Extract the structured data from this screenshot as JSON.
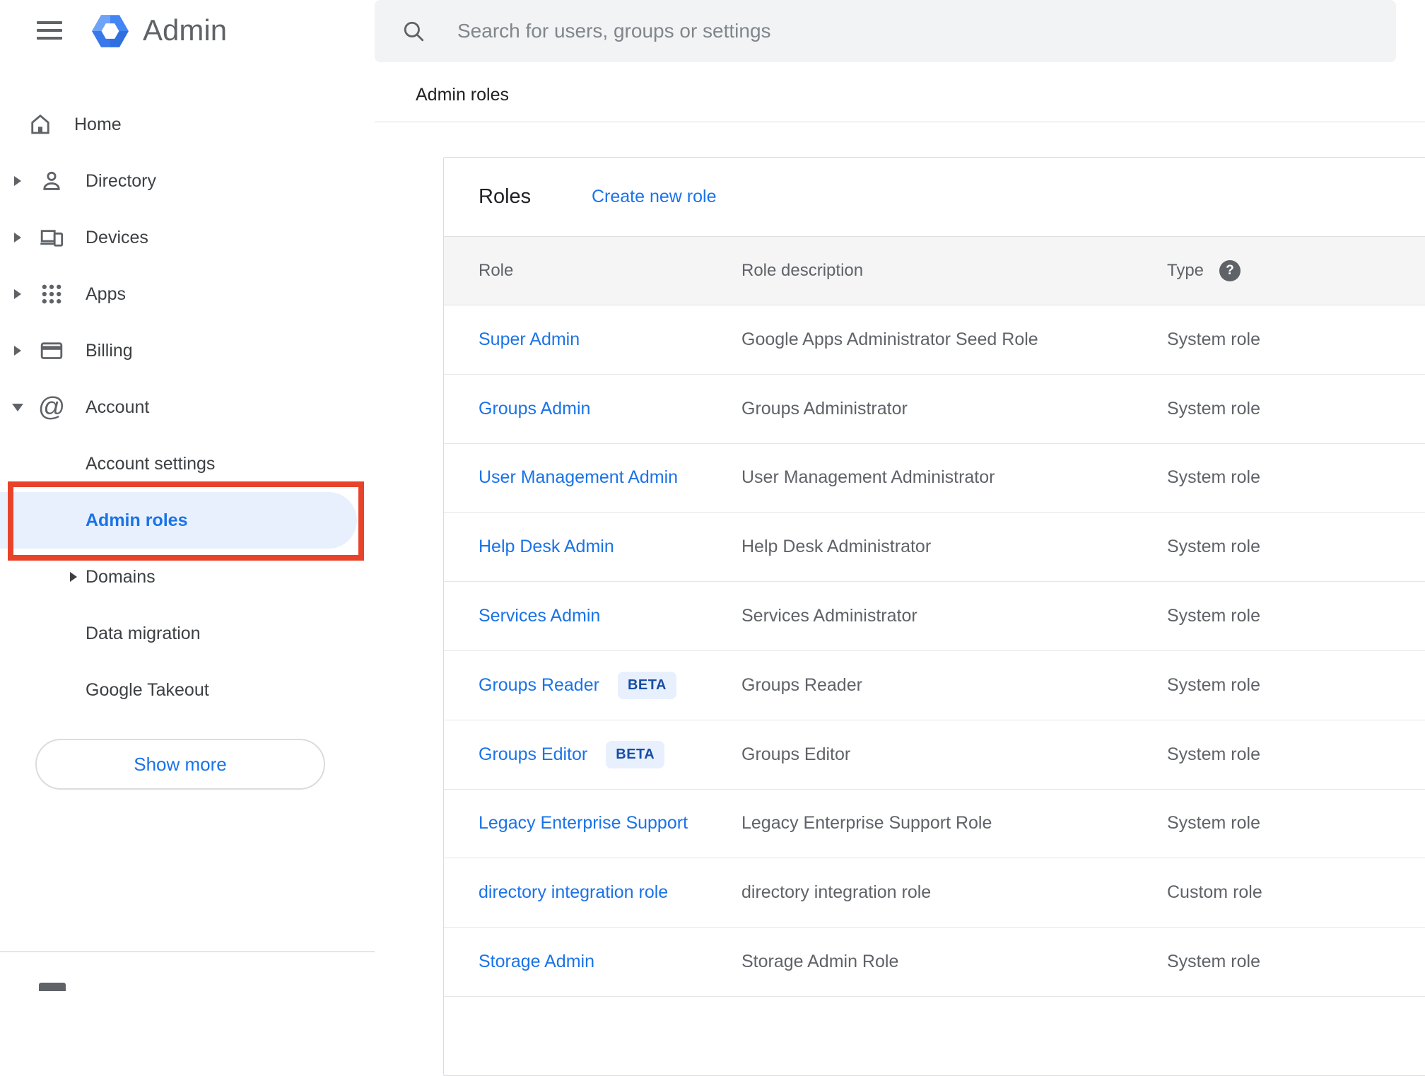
{
  "sidebar": {
    "app_title": "Admin",
    "items": [
      {
        "label": "Home",
        "icon": "home",
        "caret": null
      },
      {
        "label": "Directory",
        "icon": "person",
        "caret": "right"
      },
      {
        "label": "Devices",
        "icon": "devices",
        "caret": "right"
      },
      {
        "label": "Apps",
        "icon": "apps",
        "caret": "right"
      },
      {
        "label": "Billing",
        "icon": "card",
        "caret": "right"
      },
      {
        "label": "Account",
        "icon": "at",
        "caret": "down"
      },
      {
        "label": "Account settings",
        "child": true
      },
      {
        "label": "Admin roles",
        "child": true,
        "selected": true
      },
      {
        "label": "Domains",
        "child": true,
        "caret": "right"
      },
      {
        "label": "Data migration",
        "child": true
      },
      {
        "label": "Google Takeout",
        "child": true
      }
    ],
    "show_more_label": "Show more"
  },
  "search": {
    "placeholder": "Search for users, groups or settings"
  },
  "breadcrumb": {
    "title": "Admin roles"
  },
  "roles_card": {
    "title": "Roles",
    "create_link_label": "Create new role",
    "columns": [
      "Role",
      "Role description",
      "Type"
    ],
    "help_glyph": "?",
    "beta_label": "BETA",
    "rows": [
      {
        "role": "Super Admin",
        "beta": false,
        "description": "Google Apps Administrator Seed Role",
        "type": "System role"
      },
      {
        "role": "Groups Admin",
        "beta": false,
        "description": "Groups Administrator",
        "type": "System role"
      },
      {
        "role": "User Management Admin",
        "beta": false,
        "description": "User Management Administrator",
        "type": "System role"
      },
      {
        "role": "Help Desk Admin",
        "beta": false,
        "description": "Help Desk Administrator",
        "type": "System role"
      },
      {
        "role": "Services Admin",
        "beta": false,
        "description": "Services Administrator",
        "type": "System role"
      },
      {
        "role": "Groups Reader",
        "beta": true,
        "description": "Groups Reader",
        "type": "System role"
      },
      {
        "role": "Groups Editor",
        "beta": true,
        "description": "Groups Editor",
        "type": "System role"
      },
      {
        "role": "Legacy Enterprise Support",
        "beta": false,
        "description": "Legacy Enterprise Support Role",
        "type": "System role"
      },
      {
        "role": "directory integration role",
        "beta": false,
        "description": "directory integration role",
        "type": "Custom role"
      },
      {
        "role": "Storage Admin",
        "beta": false,
        "description": "Storage Admin Role",
        "type": "System role"
      }
    ]
  },
  "colors": {
    "accent_blue": "#1a73e8",
    "annotation_red": "#e8432a",
    "selected_item_bg": "#e8f0fe",
    "beta_badge_bg": "#e8f0fe",
    "beta_badge_text": "#174ea6"
  }
}
